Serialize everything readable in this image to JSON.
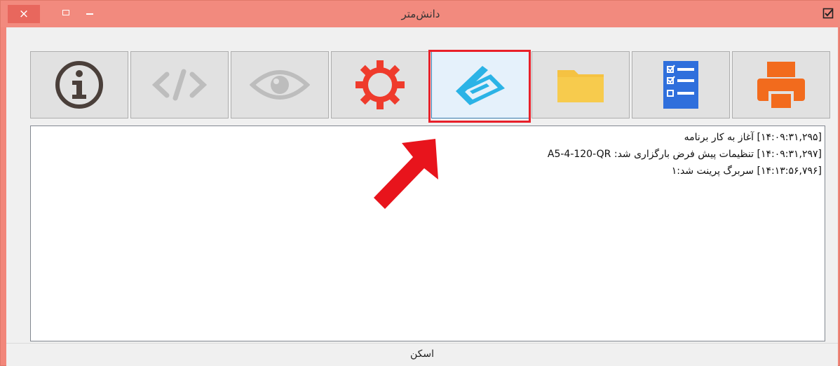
{
  "window": {
    "title": "دانش‌متر",
    "close_label": "×"
  },
  "toolbar": {
    "buttons": [
      {
        "name": "info",
        "icon": "info-icon"
      },
      {
        "name": "code",
        "icon": "code-icon"
      },
      {
        "name": "view",
        "icon": "eye-icon"
      },
      {
        "name": "settings",
        "icon": "gear-icon"
      },
      {
        "name": "scan",
        "icon": "scanner-icon",
        "selected": true
      },
      {
        "name": "folder",
        "icon": "folder-icon"
      },
      {
        "name": "checklist",
        "icon": "checklist-icon"
      },
      {
        "name": "print",
        "icon": "printer-icon"
      }
    ]
  },
  "log": {
    "lines": [
      "[۱۴:۰۹:۳۱,۲۹۵] آغاز به کار برنامه",
      "[۱۴:۰۹:۳۱,۲۹۷] تنظیمات پیش فرض بارگزاری شد: A5-4-120-QR",
      "[۱۴:۱۳:۵۶,۷۹۶] سربرگ پرینت شد:۱"
    ]
  },
  "status": {
    "text": "اسکن"
  },
  "colors": {
    "titlebar": "#f28a7e",
    "highlight": "#e8202a",
    "scanner": "#2bb3e6",
    "gear": "#ef3b2c",
    "folder": "#f5c242",
    "checklist": "#2f6fdc",
    "printer": "#f26b1d"
  }
}
